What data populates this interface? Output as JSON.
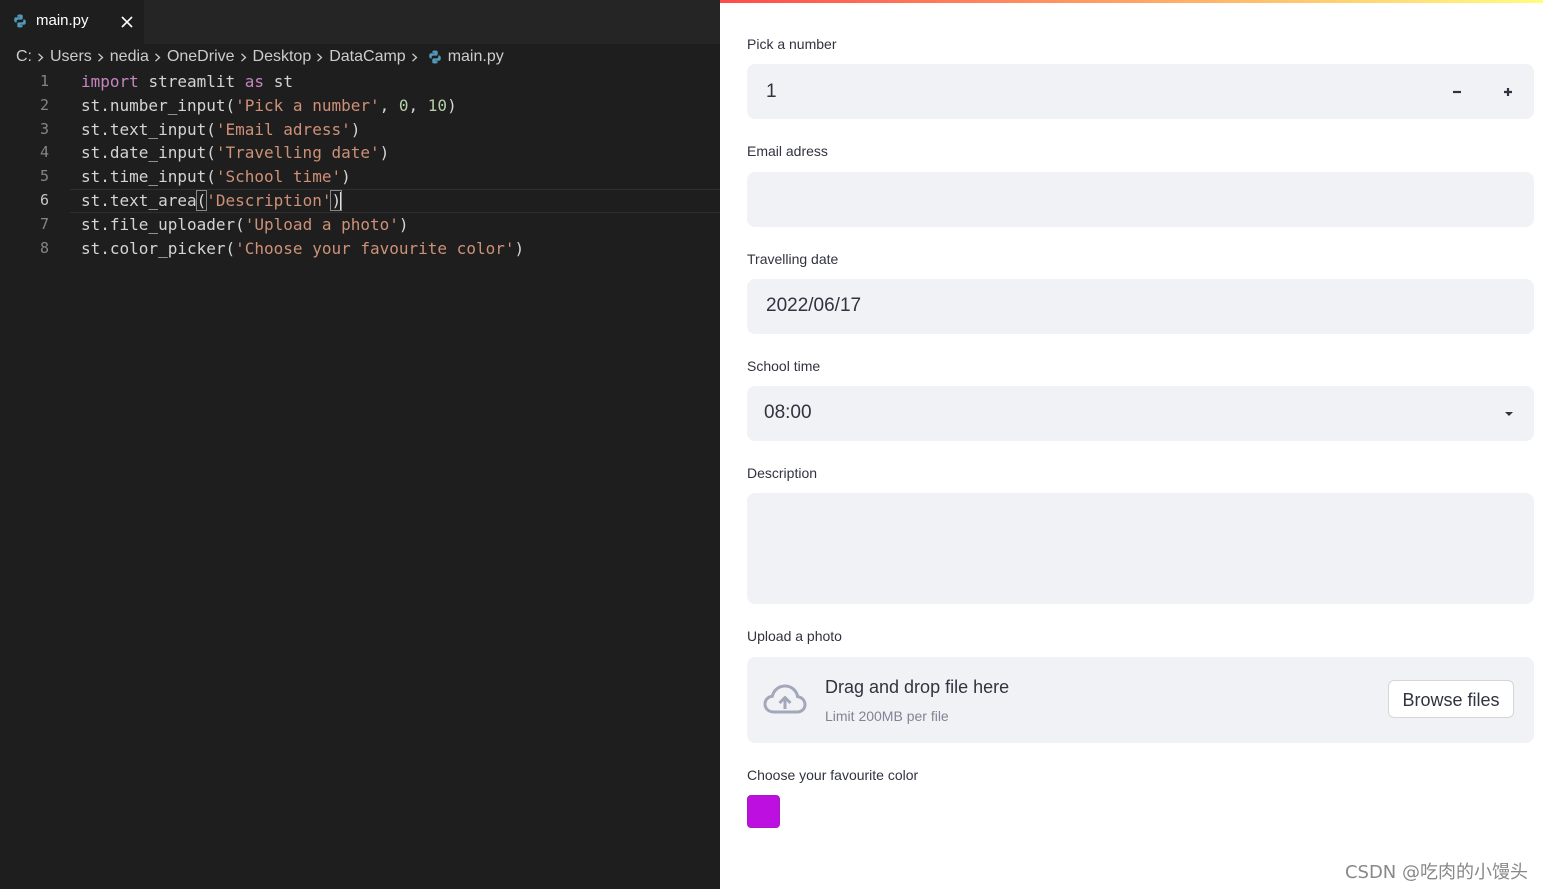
{
  "editor": {
    "tab": {
      "label": "main.py",
      "close_icon": "close-icon"
    },
    "breadcrumb": [
      "C:",
      "Users",
      "nedia",
      "OneDrive",
      "Desktop",
      "DataCamp",
      "main.py"
    ],
    "active_line": 6,
    "lines": [
      {
        "n": "1",
        "tokens": [
          [
            "kw",
            "import"
          ],
          [
            "",
            "streamlit"
          ],
          [
            "kw",
            "as"
          ],
          [
            "",
            "st"
          ]
        ]
      },
      {
        "n": "2",
        "tokens": [
          [
            "",
            "st.number_input("
          ],
          [
            "str",
            "'Pick a number'"
          ],
          [
            "",
            ", "
          ],
          [
            "num",
            "0"
          ],
          [
            "",
            ", "
          ],
          [
            "num",
            "10"
          ],
          [
            "",
            ")"
          ]
        ]
      },
      {
        "n": "3",
        "tokens": [
          [
            "",
            "st.text_input("
          ],
          [
            "str",
            "'Email adress'"
          ],
          [
            "",
            ")"
          ]
        ]
      },
      {
        "n": "4",
        "tokens": [
          [
            "",
            "st.date_input("
          ],
          [
            "str",
            "'Travelling date'"
          ],
          [
            "",
            ")"
          ]
        ]
      },
      {
        "n": "5",
        "tokens": [
          [
            "",
            "st.time_input("
          ],
          [
            "str",
            "'School time'"
          ],
          [
            "",
            ")"
          ]
        ]
      },
      {
        "n": "6",
        "tokens": [
          [
            "",
            "st.text_area"
          ],
          [
            "brk",
            "("
          ],
          [
            "str",
            "'Description'"
          ],
          [
            "brk",
            ")"
          ]
        ]
      },
      {
        "n": "7",
        "tokens": [
          [
            "",
            "st.file_uploader("
          ],
          [
            "str",
            "'Upload a photo'"
          ],
          [
            "",
            ")"
          ]
        ]
      },
      {
        "n": "8",
        "tokens": [
          [
            "",
            "st.color_picker("
          ],
          [
            "str",
            "'Choose your favourite color'"
          ],
          [
            "",
            ")"
          ]
        ]
      }
    ]
  },
  "app": {
    "number": {
      "label": "Pick a number",
      "value": "1",
      "minus": "−",
      "plus": "+"
    },
    "email": {
      "label": "Email adress",
      "value": ""
    },
    "date": {
      "label": "Travelling date",
      "value": "2022/06/17"
    },
    "time": {
      "label": "School time",
      "value": "08:00"
    },
    "description": {
      "label": "Description",
      "value": ""
    },
    "upload": {
      "label": "Upload a photo",
      "drop_text": "Drag and drop file here",
      "limit_text": "Limit 200MB per file",
      "button": "Browse files"
    },
    "color": {
      "label": "Choose your favourite color",
      "value": "#bd10e0"
    }
  },
  "watermark": "CSDN @吃肉的小馒头",
  "colors": {
    "editor_bg": "#1e1e1e",
    "keyword": "#c586c0",
    "string": "#ce9178",
    "number": "#b5cea8",
    "input_bg": "#f0f2f6"
  }
}
